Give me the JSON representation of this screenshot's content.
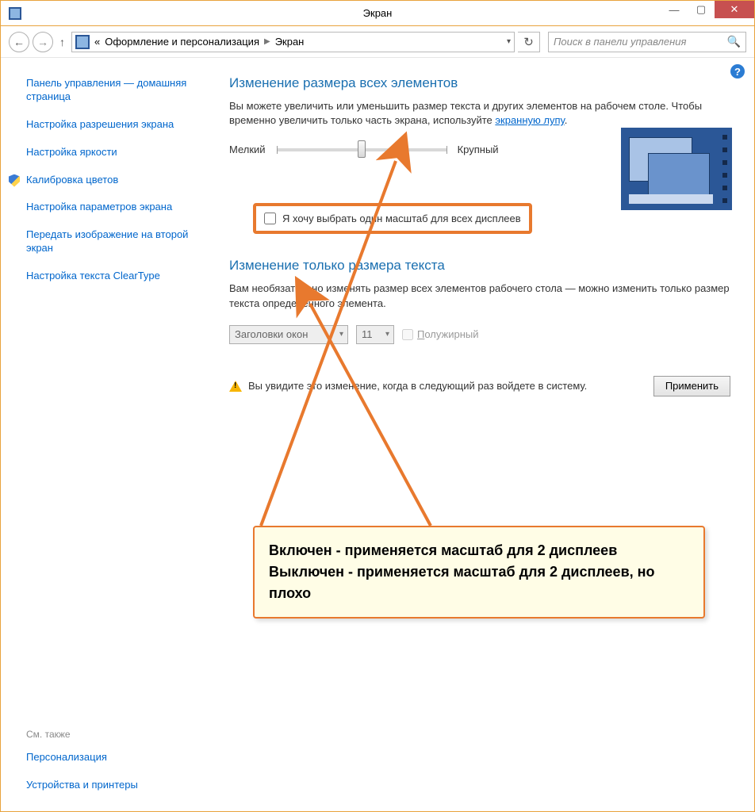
{
  "window": {
    "title": "Экран"
  },
  "nav": {
    "back": "←",
    "forward": "→",
    "up": "↑",
    "sep": "«",
    "crumb1": "Оформление и персонализация",
    "crumb2": "Экран"
  },
  "search": {
    "placeholder": "Поиск в панели управления"
  },
  "sidebar": {
    "items": [
      "Панель управления — домашняя страница",
      "Настройка разрешения экрана",
      "Настройка яркости",
      "Калибровка цветов",
      "Настройка параметров экрана",
      "Передать изображение на второй экран",
      "Настройка текста ClearType"
    ],
    "see_also": "См. также",
    "see1": "Персонализация",
    "see2": "Устройства и принтеры"
  },
  "main": {
    "h1": "Изменение размера всех элементов",
    "p1a": "Вы можете увеличить или уменьшить размер текста и других элементов на рабочем столе. Чтобы временно увеличить только часть экрана, используйте ",
    "p1link": "экранную лупу",
    "p1b": ".",
    "smaller": "Мелкий",
    "larger": "Крупный",
    "cb": "Я хочу выбрать один масштаб для всех дисплеев",
    "h2": "Изменение только размера текста",
    "p2": "Вам необязательно изменять размер всех элементов рабочего стола — можно изменить только размер текста определенного элемента.",
    "sel1": "Заголовки окон",
    "sel2": "11",
    "bold_u": "П",
    "bold_rest": "олужирный",
    "warn": "Вы увидите это изменение, когда в следующий раз войдете в систему.",
    "apply": "Применить"
  },
  "annotation": {
    "on": "Включен - применяется масштаб для 2 дисплеев",
    "off": "Выключен - применяется масштаб для 2 дисплеев, но плохо"
  }
}
